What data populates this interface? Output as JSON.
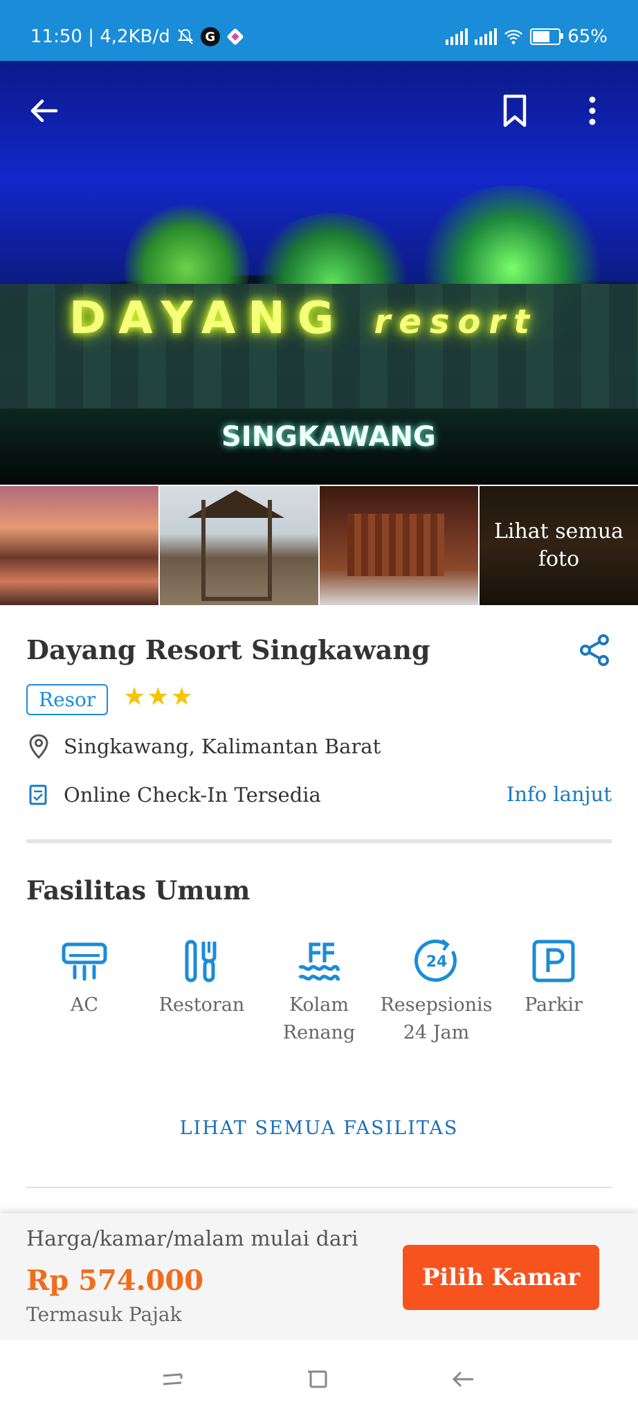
{
  "status_bar": {
    "time_speed": "11:50 | 4,2KB/d",
    "g_label": "G",
    "battery": "65%",
    "battery_level": 0.65
  },
  "hero": {
    "sign_main": "DAYANG",
    "sign_script": "resort",
    "sign_sub": "SINGKAWANG",
    "icons": [
      "back-arrow-icon",
      "bookmark-icon",
      "more-vertical-icon"
    ]
  },
  "thumbnails": {
    "see_all_label": "Lihat semua foto"
  },
  "hotel": {
    "name": "Dayang Resort Singkawang",
    "type_badge": "Resor",
    "stars": "★★★",
    "location": "Singkawang, Kalimantan Barat",
    "checkin": "Online Check-In Tersedia",
    "info_link": "Info lanjut"
  },
  "facilities": {
    "title": "Fasilitas Umum",
    "items": [
      {
        "label": "AC",
        "icon": "ac-icon"
      },
      {
        "label": "Restoran",
        "icon": "restaurant-icon"
      },
      {
        "label": "Kolam Renang",
        "icon": "pool-icon"
      },
      {
        "label": "Resepsionis 24 Jam",
        "icon": "24h-reception-icon"
      },
      {
        "label": "Parkir",
        "icon": "parking-icon"
      }
    ],
    "see_all": "LIHAT SEMUA FASILITAS"
  },
  "price": {
    "label": "Harga/kamar/malam mulai dari",
    "value": "Rp 574.000",
    "tax_note": "Termasuk Pajak",
    "button": "Pilih Kamar"
  },
  "colors": {
    "primary_blue": "#1a8cd8",
    "accent_orange": "#f7531f",
    "price_orange": "#f36b1c",
    "star_yellow": "#f6c400"
  }
}
